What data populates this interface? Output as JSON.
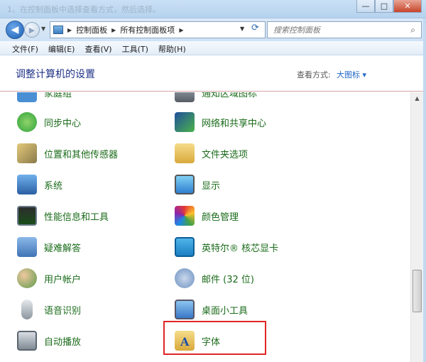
{
  "window": {
    "title": "1、在控制面板中选择查看方式，然后选择。",
    "minimize": "—",
    "maximize": "□",
    "close": "✕"
  },
  "address": {
    "breadcrumbs": [
      "控制面板",
      "所有控制面板项"
    ],
    "search_placeholder": "搜索控制面板"
  },
  "menu": [
    "文件(F)",
    "编辑(E)",
    "查看(V)",
    "工具(T)",
    "帮助(H)"
  ],
  "header": {
    "title": "调整计算机的设置",
    "view_by_label": "查看方式:",
    "view_by_value": "大图标 ▾"
  },
  "items": {
    "left": [
      {
        "label": "家庭组",
        "icon": "homegroup-icon",
        "color": "#4a8fd4"
      },
      {
        "label": "同步中心",
        "icon": "sync-center-icon",
        "color": "#2fa33a"
      },
      {
        "label": "位置和其他传感器",
        "icon": "location-sensor-icon",
        "color": "#c79b3b"
      },
      {
        "label": "系统",
        "icon": "system-icon",
        "color": "#3a7bc8"
      },
      {
        "label": "性能信息和工具",
        "icon": "performance-icon",
        "color": "#2d6a2d"
      },
      {
        "label": "疑难解答",
        "icon": "troubleshoot-icon",
        "color": "#3f73b5"
      },
      {
        "label": "用户帐户",
        "icon": "user-accounts-icon",
        "color": "#5b9a4a"
      },
      {
        "label": "语音识别",
        "icon": "microphone-icon",
        "color": "#9aa4ad"
      },
      {
        "label": "自动播放",
        "icon": "autoplay-icon",
        "color": "#4caf50"
      }
    ],
    "right": [
      {
        "label": "通知区域图标",
        "icon": "notification-area-icon",
        "color": "#555c66"
      },
      {
        "label": "网络和共享中心",
        "icon": "network-sharing-icon",
        "color": "#1f4f9b"
      },
      {
        "label": "文件夹选项",
        "icon": "folder-options-icon",
        "color": "#e8c35a"
      },
      {
        "label": "显示",
        "icon": "display-icon",
        "color": "#2f7fd0"
      },
      {
        "label": "颜色管理",
        "icon": "color-management-icon",
        "color": "#d9534f"
      },
      {
        "label": "英特尔® 核芯显卡",
        "icon": "intel-graphics-icon",
        "color": "#1b7fc3"
      },
      {
        "label": "邮件 (32 位)",
        "icon": "mail-icon",
        "color": "#6b8fbf"
      },
      {
        "label": "桌面小工具",
        "icon": "desktop-gadgets-icon",
        "color": "#3a78c6"
      },
      {
        "label": "字体",
        "icon": "fonts-folder-icon",
        "color": "#e8c35a"
      }
    ]
  }
}
